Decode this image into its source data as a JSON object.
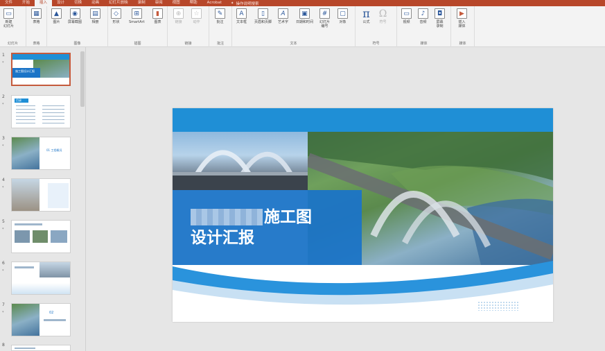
{
  "menubar": {
    "tabs": [
      "文件",
      "开始",
      "插入",
      "设计",
      "切换",
      "动画",
      "幻灯片放映",
      "录制",
      "审阅",
      "视图",
      "帮助",
      "Acrobat"
    ],
    "active_tab": "插入",
    "tell_me": "操作说明搜索"
  },
  "ribbon": {
    "groups": [
      {
        "label": "幻灯片",
        "buttons": [
          "新建\n幻灯片"
        ]
      },
      {
        "label": "表格",
        "buttons": [
          "表格"
        ]
      },
      {
        "label": "图像",
        "buttons": [
          "图片",
          "屏幕截图",
          "相册"
        ]
      },
      {
        "label": "插图",
        "buttons": [
          "形状",
          "SmartArt",
          "图表"
        ]
      },
      {
        "label": "链接",
        "buttons": [
          "链接",
          "动作"
        ]
      },
      {
        "label": "批注",
        "buttons": [
          "批注"
        ]
      },
      {
        "label": "文本",
        "buttons": [
          "文本框",
          "页眉和页脚",
          "艺术字",
          "日期和时间",
          "幻灯片\n编号",
          "对象"
        ]
      },
      {
        "label": "符号",
        "buttons": [
          "公式",
          "符号"
        ]
      },
      {
        "label": "媒体",
        "buttons": [
          "视频",
          "音频",
          "屏幕\n录制"
        ]
      },
      {
        "label": "媒体",
        "buttons": [
          "插入\n媒体"
        ]
      }
    ]
  },
  "thumbnails": [
    {
      "num": "1",
      "caption": "施工图设计汇报"
    },
    {
      "num": "2",
      "caption": "目录"
    },
    {
      "num": "3",
      "caption": "01 工程概况"
    },
    {
      "num": "4",
      "caption": ""
    },
    {
      "num": "5",
      "caption": ""
    },
    {
      "num": "6",
      "caption": ""
    },
    {
      "num": "7",
      "caption": "02"
    },
    {
      "num": "8",
      "caption": ""
    }
  ],
  "slide": {
    "title_line1": "施工图",
    "title_line2": "设计汇报",
    "accent_color": "#1b74c7",
    "bar_color": "#1f8fd6"
  }
}
